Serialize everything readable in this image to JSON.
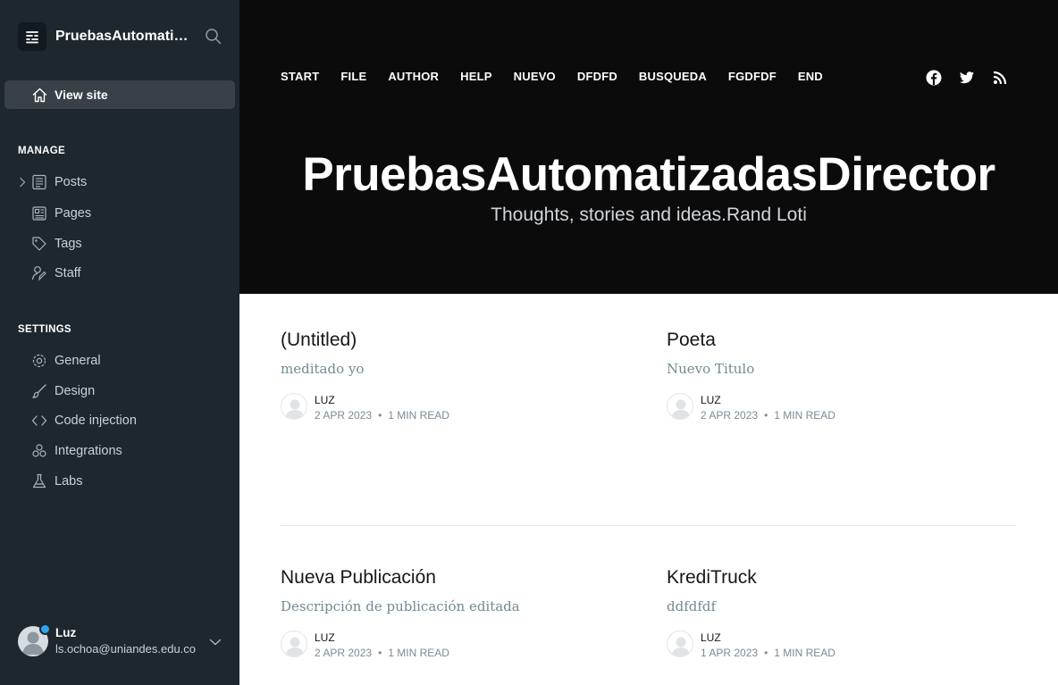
{
  "sidebar": {
    "site_name": "PruebasAutomatizadasDirector",
    "view_site": "View site",
    "manage_title": "MANAGE",
    "manage_items": [
      {
        "label": "Posts",
        "icon": "posts-icon"
      },
      {
        "label": "Pages",
        "icon": "pages-icon"
      },
      {
        "label": "Tags",
        "icon": "tag-icon"
      },
      {
        "label": "Staff",
        "icon": "staff-icon"
      }
    ],
    "settings_title": "SETTINGS",
    "settings_items": [
      {
        "label": "General",
        "icon": "gear-icon"
      },
      {
        "label": "Design",
        "icon": "brush-icon"
      },
      {
        "label": "Code injection",
        "icon": "code-icon"
      },
      {
        "label": "Integrations",
        "icon": "integrations-icon"
      },
      {
        "label": "Labs",
        "icon": "flask-icon"
      }
    ],
    "user": {
      "name": "Luz",
      "email": "ls.ochoa@uniandes.edu.co"
    }
  },
  "site": {
    "nav": [
      "START",
      "FILE",
      "AUTHOR",
      "HELP",
      "NUEVO",
      "DFDFD",
      "BUSQUEDA",
      "FGDFDF",
      "END"
    ],
    "social": [
      "facebook-icon",
      "twitter-icon",
      "rss-icon"
    ],
    "title": "PruebasAutomatizadasDirector",
    "description": "Thoughts, stories and ideas.Rand Loti"
  },
  "posts": [
    {
      "title": "(Untitled)",
      "excerpt": "meditado yo",
      "author": "LUZ",
      "date": "2 APR 2023",
      "read": "1 MIN READ"
    },
    {
      "title": "Poeta",
      "excerpt": "Nuevo Titulo",
      "author": "LUZ",
      "date": "2 APR 2023",
      "read": "1 MIN READ"
    },
    {
      "title": "Nueva Publicación",
      "excerpt": "Descripción de publicación editada",
      "author": "LUZ",
      "date": "2 APR 2023",
      "read": "1 MIN READ"
    },
    {
      "title": "KrediTruck",
      "excerpt": "ddfdfdf",
      "author": "LUZ",
      "date": "1 APR 2023",
      "read": "1 MIN READ"
    }
  ],
  "colors": {
    "sidebar_bg": "#1f272e",
    "hero_bg": "#0b0b0c",
    "accent_dot": "#2aa7ef"
  }
}
